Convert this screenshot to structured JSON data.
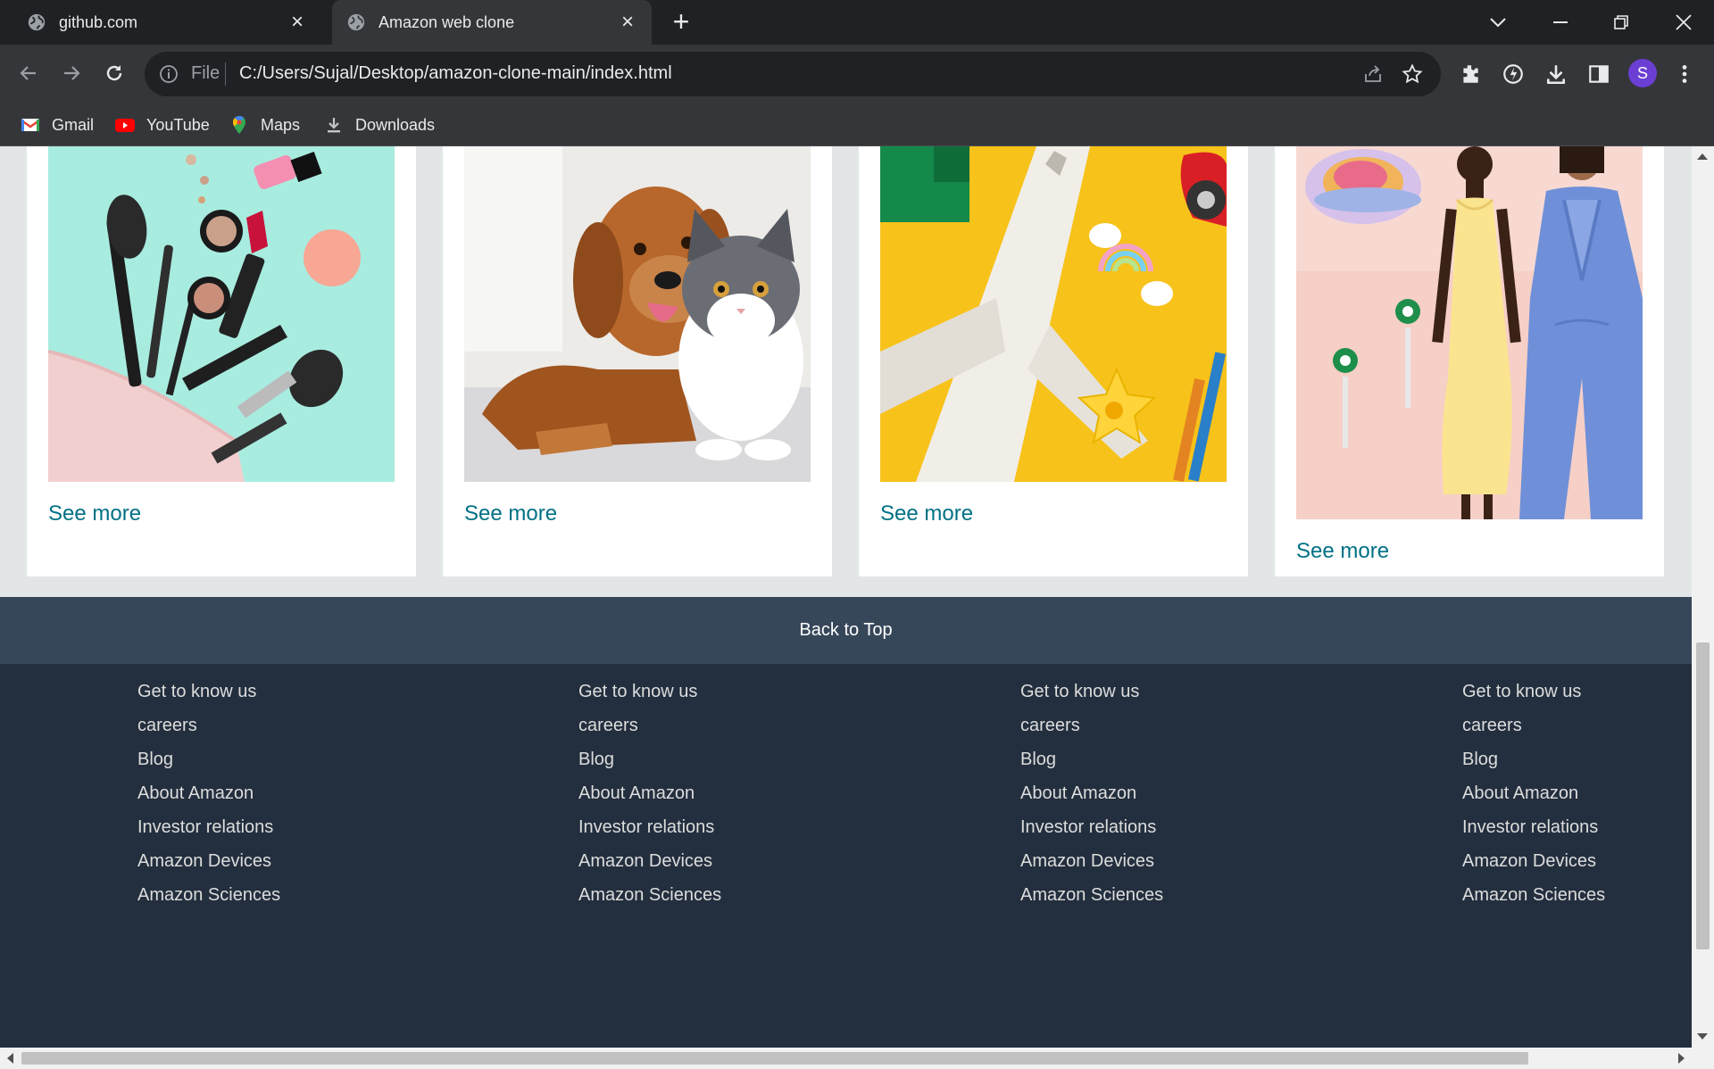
{
  "browser": {
    "tabs": [
      {
        "title": "github.com",
        "active": false
      },
      {
        "title": "Amazon web clone",
        "active": true
      }
    ],
    "address": {
      "scheme_label": "File",
      "url": "C:/Users/Sujal/Desktop/amazon-clone-main/index.html"
    },
    "profile_initial": "S",
    "bookmarks": [
      {
        "label": "Gmail",
        "icon": "gmail-icon"
      },
      {
        "label": "YouTube",
        "icon": "youtube-icon"
      },
      {
        "label": "Maps",
        "icon": "maps-icon"
      },
      {
        "label": "Downloads",
        "icon": "download-icon"
      }
    ]
  },
  "page": {
    "cards": [
      {
        "image": "makeup-products-image",
        "link": "See more"
      },
      {
        "image": "dog-and-cat-image",
        "link": "See more"
      },
      {
        "image": "toy-airplane-image",
        "link": "See more"
      },
      {
        "image": "fashion-models-image",
        "link": "See more"
      }
    ],
    "back_to_top": "Back to Top",
    "footer_columns": [
      {
        "links": [
          "Get to know us",
          "careers",
          "Blog",
          "About Amazon",
          "Investor relations",
          "Amazon Devices",
          "Amazon Sciences"
        ]
      },
      {
        "links": [
          "Get to know us",
          "careers",
          "Blog",
          "About Amazon",
          "Investor relations",
          "Amazon Devices",
          "Amazon Sciences"
        ]
      },
      {
        "links": [
          "Get to know us",
          "careers",
          "Blog",
          "About Amazon",
          "Investor relations",
          "Amazon Devices",
          "Amazon Sciences"
        ]
      },
      {
        "links": [
          "Get to know us",
          "careers",
          "Blog",
          "About Amazon",
          "Investor relations",
          "Amazon Devices",
          "Amazon Sciences"
        ]
      }
    ]
  },
  "colors": {
    "link": "#007185",
    "back_to_top_bg": "#37475a",
    "footer_bg": "#232f3e",
    "page_bg": "#e3e6e6"
  }
}
